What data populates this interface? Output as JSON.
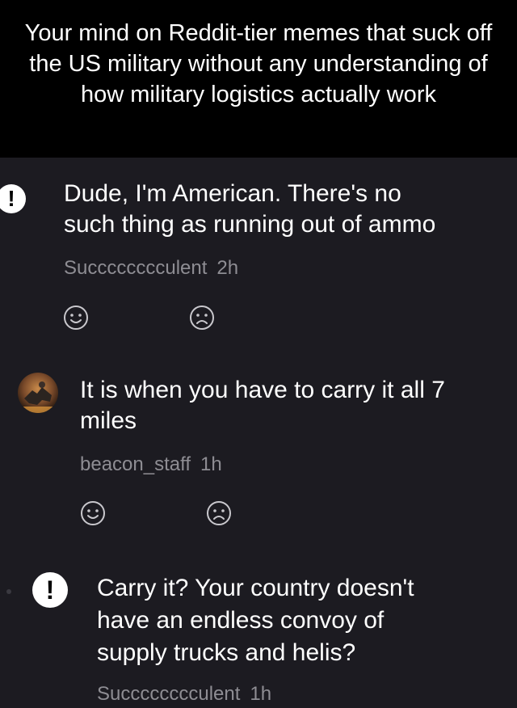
{
  "caption": "Your mind on Reddit-tier memes that suck off the US military without any understanding of how military logistics actually work",
  "comments": [
    {
      "avatar_icon": "exclamation-avatar-icon",
      "text_line1": "Dude, I'm American. There's no",
      "text_line2": "such thing as running out of ammo",
      "username": "Succcccccculent",
      "time": "2h",
      "like_icon": "smiley-face-icon",
      "dislike_icon": "frowning-face-icon"
    },
    {
      "avatar_icon": "photo-avatar-icon",
      "text_line1": "It is when you have to carry it all 7",
      "text_line2": "miles",
      "username": "beacon_staff",
      "time": "1h",
      "like_icon": "smiley-face-icon",
      "dislike_icon": "frowning-face-icon"
    },
    {
      "avatar_icon": "exclamation-avatar-icon",
      "text_line1": "Carry it? Your country doesn't",
      "text_line2": "have an endless convoy of",
      "text_line3": "supply trucks and helis?",
      "username": "Succcccccculent",
      "time": "1h"
    }
  ],
  "colors": {
    "background": "#1c1b21",
    "caption_background": "#000000",
    "text": "#ffffff",
    "meta_text": "#8e8d93",
    "reaction_icon": "#c9c8cd"
  }
}
